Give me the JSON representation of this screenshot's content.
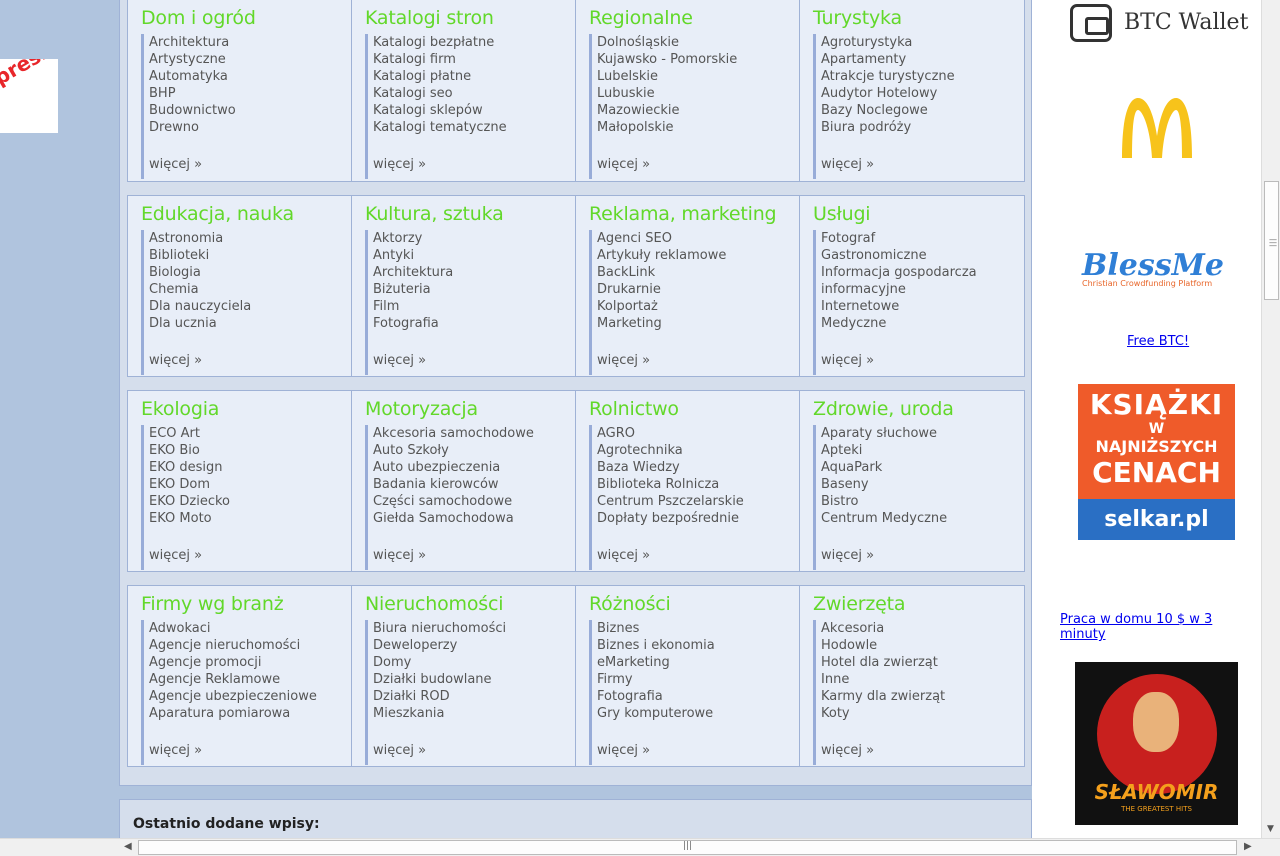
{
  "left_ad": {
    "text": "press"
  },
  "categories": [
    [
      {
        "title": "Dom i ogród",
        "links": [
          "Architektura",
          "Artystyczne",
          "Automatyka",
          "BHP",
          "Budownictwo",
          "Drewno"
        ],
        "more": "więcej »"
      },
      {
        "title": "Katalogi stron",
        "links": [
          "Katalogi bezpłatne",
          "Katalogi firm",
          "Katalogi płatne",
          "Katalogi seo",
          "Katalogi sklepów",
          "Katalogi tematyczne"
        ],
        "more": "więcej »"
      },
      {
        "title": "Regionalne",
        "links": [
          "Dolnośląskie",
          "Kujawsko - Pomorskie",
          "Lubelskie",
          "Lubuskie",
          "Mazowieckie",
          "Małopolskie"
        ],
        "more": "więcej »"
      },
      {
        "title": "Turystyka",
        "links": [
          "Agroturystyka",
          "Apartamenty",
          "Atrakcje turystyczne",
          "Audytor Hotelowy",
          "Bazy Noclegowe",
          "Biura podróży"
        ],
        "more": "więcej »"
      }
    ],
    [
      {
        "title": "Edukacja, nauka",
        "links": [
          "Astronomia",
          "Biblioteki",
          "Biologia",
          "Chemia",
          "Dla nauczyciela",
          "Dla ucznia"
        ],
        "more": "więcej »"
      },
      {
        "title": "Kultura, sztuka",
        "links": [
          "Aktorzy",
          "Antyki",
          "Architektura",
          "Biżuteria",
          "Film",
          "Fotografia"
        ],
        "more": "więcej »"
      },
      {
        "title": "Reklama, marketing",
        "links": [
          "Agenci SEO",
          "Artykuły reklamowe",
          "BackLink",
          "Drukarnie",
          "Kolportaż",
          "Marketing"
        ],
        "more": "więcej »"
      },
      {
        "title": "Usługi",
        "links": [
          "Fotograf",
          "Gastronomiczne",
          "Informacja gospodarcza",
          "informacyjne",
          "Internetowe",
          "Medyczne"
        ],
        "more": "więcej »"
      }
    ],
    [
      {
        "title": "Ekologia",
        "links": [
          "ECO Art",
          "EKO Bio",
          "EKO design",
          "EKO Dom",
          "EKO Dziecko",
          "EKO Moto"
        ],
        "more": "więcej »"
      },
      {
        "title": "Motoryzacja",
        "links": [
          "Akcesoria samochodowe",
          "Auto Szkoły",
          "Auto ubezpieczenia",
          "Badania kierowców",
          "Części samochodowe",
          "Giełda Samochodowa"
        ],
        "more": "więcej »"
      },
      {
        "title": "Rolnictwo",
        "links": [
          "AGRO",
          "Agrotechnika",
          "Baza Wiedzy",
          "Biblioteka Rolnicza",
          "Centrum Pszczelarskie",
          "Dopłaty bezpośrednie"
        ],
        "more": "więcej »"
      },
      {
        "title": "Zdrowie, uroda",
        "links": [
          "Aparaty słuchowe",
          "Apteki",
          "AquaPark",
          "Baseny",
          "Bistro",
          "Centrum Medyczne"
        ],
        "more": "więcej »"
      }
    ],
    [
      {
        "title": "Firmy wg branż",
        "links": [
          "Adwokaci",
          "Agencje nieruchomości",
          "Agencje promocji",
          "Agencje Reklamowe",
          "Agencje ubezpieczeniowe",
          "Aparatura pomiarowa"
        ],
        "more": "więcej »"
      },
      {
        "title": "Nieruchomości",
        "links": [
          "Biura nieruchomości",
          "Deweloperzy",
          "Domy",
          "Działki budowlane",
          "Działki ROD",
          "Mieszkania"
        ],
        "more": "więcej »"
      },
      {
        "title": "Różności",
        "links": [
          "Biznes",
          "Biznes i ekonomia",
          "eMarketing",
          "Firmy",
          "Fotografia",
          "Gry komputerowe"
        ],
        "more": "więcej »"
      },
      {
        "title": "Zwierzęta",
        "links": [
          "Akcesoria",
          "Hodowle",
          "Hotel dla zwierząt",
          "Inne",
          "Karmy dla zwierząt",
          "Koty"
        ],
        "more": "więcej »"
      }
    ]
  ],
  "recent": {
    "label": "Ostatnio dodane wpisy:"
  },
  "sidebar": {
    "btc_wallet": "BTC Wallet",
    "blessme_title": "BlessMe",
    "blessme_sub": "Christian Crowdfunding Platform",
    "free_btc": "Free BTC!",
    "ksiazki": {
      "l1": "KSIĄŻKI",
      "l2": "W",
      "l3": "NAJNIŻSZYCH",
      "l4": "CENACH",
      "brand": "selkar.pl"
    },
    "praca": "Praca w domu 10 $ w 3 minuty",
    "slawomir": {
      "title": "SŁAWOMIR",
      "sub": "THE GREATEST HITS"
    }
  },
  "colors": {
    "category_title": "#62d82a",
    "link": "#555555",
    "more": "#8ba6d8",
    "panel": "#d5deec",
    "page_bg": "#b0c4de"
  }
}
